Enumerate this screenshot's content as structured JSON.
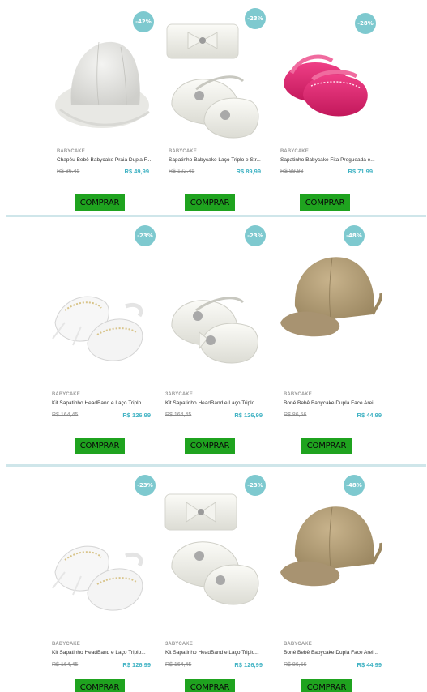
{
  "rows": [
    {
      "products": [
        {
          "badge": "-42%",
          "brand": "BABYCAKE",
          "name": "Chapéu Bebê Babycake Praia Dupla F...",
          "old_price": "R$ 86,45",
          "price": "R$ 49,99",
          "buy_label": "COMPRAR",
          "image": "hat-icon"
        },
        {
          "badge": "-23%",
          "brand": "BABYCAKE",
          "name": "Sapatinho Babycake Laço Triplo e Str...",
          "old_price": "R$ 122,45",
          "price": "R$ 89,99",
          "buy_label": "COMPRAR",
          "image": "shoes-headband-icon"
        },
        {
          "badge": "-28%",
          "brand": "BABYCAKE",
          "name": "Sapatinho Babycake Fita Pregueada e...",
          "old_price": "R$ 99,98",
          "price": "R$ 71,99",
          "buy_label": "COMPRAR",
          "image": "pink-shoes-icon"
        }
      ]
    },
    {
      "products": [
        {
          "badge": "-23%",
          "brand": "BABYCAKE",
          "name": "Kit Sapatinho HeadBand e Laço Triplo...",
          "old_price": "R$ 164,45",
          "price": "R$ 126,99",
          "buy_label": "COMPRAR",
          "image": "sheer-shoes-icon"
        },
        {
          "badge": "-23%",
          "brand": "3ABYCAKE",
          "name": "Kit Sapatinho HeadBand e Laço Triplo...",
          "old_price": "R$ 164,45",
          "price": "R$ 126,99",
          "buy_label": "COMPRAR",
          "image": "white-shoes-icon"
        },
        {
          "badge": "-48%",
          "brand": "BABYCAKE",
          "name": "Boné Bebê Babycake Dupla Face Arei...",
          "old_price": "R$ 86,56",
          "price": "R$ 44,99",
          "buy_label": "COMPRAR",
          "image": "cap-icon"
        }
      ]
    },
    {
      "products": [
        {
          "badge": "-23%",
          "brand": "BABYCAKE",
          "name": "Kit Sapatinho HeadBand e Laço Triplo...",
          "old_price": "R$ 164,45",
          "price": "R$ 126,99",
          "buy_label": "COMPRAR",
          "image": "sheer-shoes-icon"
        },
        {
          "badge": "-23%",
          "brand": "3ABYCAKE",
          "name": "Kit Sapatinho HeadBand e Laço Triplo...",
          "old_price": "R$ 164,45",
          "price": "R$ 126,99",
          "buy_label": "COMPRAR",
          "image": "shoes-headband-icon"
        },
        {
          "badge": "-48%",
          "brand": "BABYCAKE",
          "name": "Boné Bebê Babycake Dupla Face Arei...",
          "old_price": "R$ 86,56",
          "price": "R$ 44,99",
          "buy_label": "COMPRAR",
          "image": "cap-icon"
        }
      ]
    }
  ],
  "colors": {
    "accent": "#3fb2c3",
    "badge": "#7ec9cf",
    "buy": "#1fa31f",
    "divider": "#cfe6ea"
  }
}
